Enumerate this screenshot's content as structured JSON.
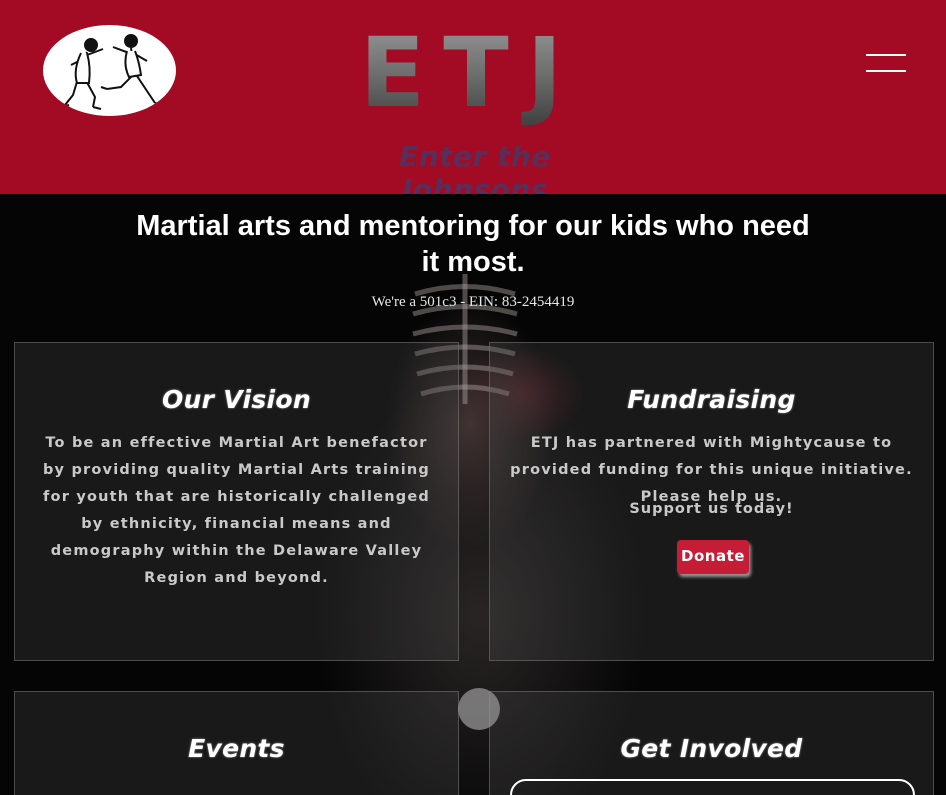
{
  "header": {
    "brand": "ETJ",
    "tagline": "Enter the Johnsons",
    "colors": {
      "background": "#a30a23",
      "tagline": "#56305a"
    },
    "logo_icon": "martial-artists-sparring-icon",
    "menu_icon": "hamburger-menu-icon"
  },
  "hero": {
    "headline": "Martial arts and mentoring for our kids who need it most.",
    "ein_line": "We're a 501c3 - EIN: 83-2454419"
  },
  "cards": {
    "vision": {
      "title": "Our Vision",
      "body": "To be an effective Martial Art benefactor by providing quality Martial Arts training for youth that are historically challenged by ethnicity, financial means and demography within the Delaware Valley Region and beyond."
    },
    "fundraising": {
      "title": "Fundraising",
      "body": "ETJ has partnered with Mightycause to provided funding for this unique initiative. Please help us.",
      "support": "Support us today!",
      "donate_label": "Donate",
      "donate_color": "#c51d36"
    },
    "events": {
      "title": "Events"
    },
    "involved": {
      "title": "Get Involved"
    }
  }
}
